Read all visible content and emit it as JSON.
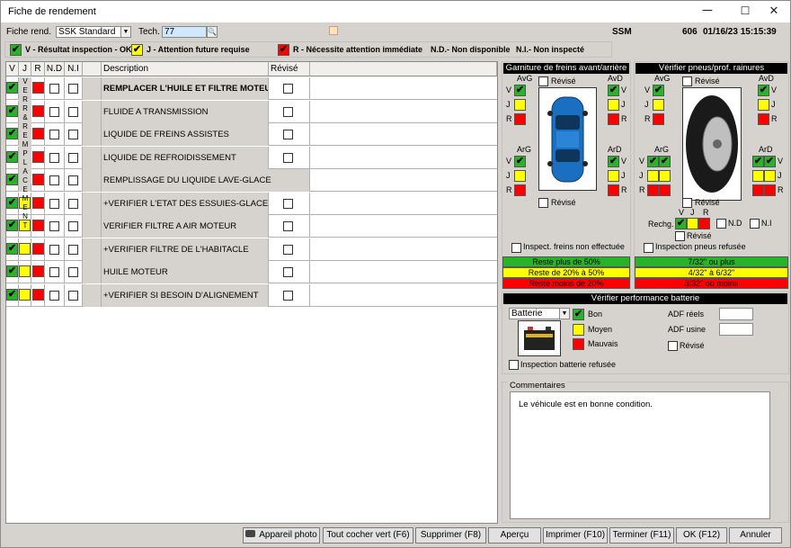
{
  "window": {
    "title": "Fiche de rendement",
    "minimize": "─",
    "maximize": "☐",
    "close": "✕"
  },
  "top": {
    "fiche_label": "Fiche rend.",
    "fiche_value": "SSK Standard",
    "tech_label": "Tech.",
    "tech_value": "77",
    "ssm": "SSM",
    "code": "606",
    "datetime": "01/16/23 15:15:39"
  },
  "legend": {
    "v": "V - Résultat inspection - OK",
    "j": "J - Attention future requise",
    "r": "R - Nécessite attention immédiate",
    "nd": "N.D.- Non disponible",
    "ni": "N.I.- Non inspecté"
  },
  "grid": {
    "headers": [
      "V",
      "J",
      "R",
      "N.D",
      "N.I",
      "",
      "Description",
      "Révisé"
    ],
    "verre_text": "V\nE\nR\nR\n&\nR\nE\nM\nP\nL\nA\nC\nE\nM\nE\nN\nT",
    "verre_label": "VERRE & REMPLACEMENT",
    "rows": [
      {
        "desc": "REMPLACER L'HUILE ET FILTRE MOTEUR",
        "bold": true,
        "v": true
      },
      {
        "desc": "FLUIDE A TRANSMISSION",
        "v": true
      },
      {
        "desc": "LIQUIDE DE FREINS ASSISTES",
        "v": true
      },
      {
        "desc": "LIQUIDE DE REFROIDISSEMENT",
        "v": true
      },
      {
        "desc": "REMPLISSAGE DU LIQUIDE LAVE-GLACE",
        "v": true
      },
      {
        "desc": "+VERIFIER L'ETAT DES ESSUIES-GLACE",
        "v": true
      },
      {
        "desc": "VERIFIER FILTRE A AIR MOTEUR",
        "v": true
      },
      {
        "desc": "+VERIFIER FILTRE DE L'HABITACLE",
        "v": true
      },
      {
        "desc": "HUILE MOTEUR",
        "v": true
      },
      {
        "desc": "+VERIFIER SI BESOIN D'ALIGNEMENT",
        "v": true
      }
    ]
  },
  "brakes": {
    "title": "Garniture de freins avant/arrière",
    "avg": "AvG",
    "avd": "AvD",
    "arg": "ArG",
    "ard": "ArD",
    "revise": "Révisé",
    "v": "V",
    "j": "J",
    "r": "R",
    "not_done": "Inspect. freins non effectuée",
    "bands": [
      "Reste plus de 50%",
      "Reste de 20% à 50%",
      "Reste moins de 20%"
    ]
  },
  "tires": {
    "title": "Vérifier pneus/prof. rainures",
    "avg": "AvG",
    "avd": "AvD",
    "arg": "ArG",
    "ard": "ArD",
    "revise": "Révisé",
    "rechg": "Rechg.",
    "nd": "N.D",
    "ni": "N.I",
    "v": "V",
    "j": "J",
    "r": "R",
    "refused": "Inspection pneus refusée",
    "bands": [
      "7/32\" ou plus",
      "4/32\" à 6/32\"",
      "3/32\" ou moins"
    ]
  },
  "battery": {
    "title": "Vérifier performance batterie",
    "select": "Batterie",
    "bon": "Bon",
    "moyen": "Moyen",
    "mauvais": "Mauvais",
    "adf_reels": "ADF réels",
    "adf_usine": "ADF usine",
    "revise": "Révisé",
    "refused": "Inspection batterie refusée"
  },
  "comments": {
    "label": "Commentaires",
    "text": "Le véhicule est en bonne condition."
  },
  "buttons": [
    "Appareil photo",
    "Tout cocher vert (F6)",
    "Supprimer (F8)",
    "Aperçu",
    "Imprimer (F10)",
    "Terminer (F11)",
    "OK (F12)",
    "Annuler"
  ],
  "colors": {
    "green": "#28b428",
    "yellow": "#ffff00",
    "red": "#ff0000"
  }
}
